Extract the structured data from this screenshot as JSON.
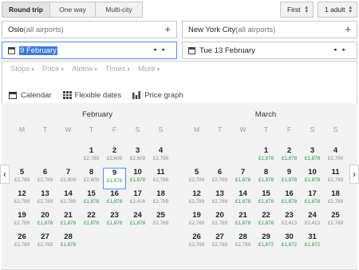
{
  "trip_type": {
    "options": [
      {
        "label": "Round trip",
        "selected": true
      },
      {
        "label": "One way",
        "selected": false
      },
      {
        "label": "Multi-city",
        "selected": false
      }
    ]
  },
  "cabin": {
    "value": "First"
  },
  "passengers": {
    "value": "1 adult"
  },
  "origin": {
    "value": "Oslo",
    "suffix": " (all airports)"
  },
  "destination": {
    "value": "New York City",
    "suffix": " (all airports)"
  },
  "depart": {
    "value": "9 February"
  },
  "return": {
    "value": "Tue 13 February"
  },
  "filters": [
    "Stops",
    "Price",
    "Airline",
    "Times",
    "More"
  ],
  "views": [
    {
      "label": "Calendar",
      "icon": "calendar-icon",
      "active": true
    },
    {
      "label": "Flexible dates",
      "icon": "grid-icon",
      "active": false
    },
    {
      "label": "Price graph",
      "icon": "bar-chart-icon",
      "active": false
    }
  ],
  "weekdays": [
    "M",
    "T",
    "W",
    "T",
    "F",
    "S",
    "S"
  ],
  "months": [
    {
      "name": "February",
      "weeks": [
        [
          null,
          null,
          null,
          {
            "d": "1",
            "p": "£2,789"
          },
          {
            "d": "2",
            "p": "£2,609"
          },
          {
            "d": "3",
            "p": "£2,609"
          },
          {
            "d": "4",
            "p": "£2,789"
          }
        ],
        [
          {
            "d": "5",
            "p": "£2,789"
          },
          {
            "d": "6",
            "p": "£2,789"
          },
          {
            "d": "7",
            "p": "£2,609"
          },
          {
            "d": "8",
            "p": "£2,609"
          },
          {
            "d": "9",
            "p": "£1,878",
            "g": true,
            "sel": true
          },
          {
            "d": "10",
            "p": "£1,878",
            "g": true
          },
          {
            "d": "11",
            "p": "£2,789"
          }
        ],
        [
          {
            "d": "12",
            "p": "£2,789"
          },
          {
            "d": "13",
            "p": "£2,789"
          },
          {
            "d": "14",
            "p": "£2,789"
          },
          {
            "d": "15",
            "p": "£1,878",
            "g": true
          },
          {
            "d": "16",
            "p": "£1,878",
            "g": true
          },
          {
            "d": "17",
            "p": "£2,416"
          },
          {
            "d": "18",
            "p": "£2,789"
          }
        ],
        [
          {
            "d": "19",
            "p": "£2,789"
          },
          {
            "d": "20",
            "p": "£1,878",
            "g": true
          },
          {
            "d": "21",
            "p": "£1,878",
            "g": true
          },
          {
            "d": "22",
            "p": "£1,878",
            "g": true
          },
          {
            "d": "23",
            "p": "£1,878",
            "g": true
          },
          {
            "d": "24",
            "p": "£1,878",
            "g": true
          },
          {
            "d": "25",
            "p": "£2,789"
          }
        ],
        [
          {
            "d": "26",
            "p": "£2,789"
          },
          {
            "d": "27",
            "p": "£2,789"
          },
          {
            "d": "28",
            "p": "£1,878",
            "g": true
          },
          null,
          null,
          null,
          null
        ]
      ]
    },
    {
      "name": "March",
      "weeks": [
        [
          null,
          null,
          null,
          {
            "d": "1",
            "p": "£1,878",
            "g": true
          },
          {
            "d": "2",
            "p": "£1,878",
            "g": true
          },
          {
            "d": "3",
            "p": "£1,878",
            "g": true
          },
          {
            "d": "4",
            "p": "£2,789"
          }
        ],
        [
          {
            "d": "5",
            "p": "£2,789"
          },
          {
            "d": "6",
            "p": "£2,789"
          },
          {
            "d": "7",
            "p": "£1,878",
            "g": true
          },
          {
            "d": "8",
            "p": "£1,878",
            "g": true
          },
          {
            "d": "9",
            "p": "£1,878",
            "g": true
          },
          {
            "d": "10",
            "p": "£1,878",
            "g": true
          },
          {
            "d": "11",
            "p": "£2,789"
          }
        ],
        [
          {
            "d": "12",
            "p": "£2,789"
          },
          {
            "d": "13",
            "p": "£2,789"
          },
          {
            "d": "14",
            "p": "£1,878",
            "g": true
          },
          {
            "d": "15",
            "p": "£1,878",
            "g": true
          },
          {
            "d": "16",
            "p": "£1,878",
            "g": true
          },
          {
            "d": "17",
            "p": "£1,878",
            "g": true
          },
          {
            "d": "18",
            "p": "£2,789"
          }
        ],
        [
          {
            "d": "19",
            "p": "£2,789"
          },
          {
            "d": "20",
            "p": "£2,789"
          },
          {
            "d": "21",
            "p": "£1,878",
            "g": true
          },
          {
            "d": "22",
            "p": "£1,878",
            "g": true
          },
          {
            "d": "23",
            "p": "£2,413"
          },
          {
            "d": "24",
            "p": "£2,413"
          },
          {
            "d": "25",
            "p": "£2,789"
          }
        ],
        [
          {
            "d": "26",
            "p": "£2,789"
          },
          {
            "d": "27",
            "p": "£2,789"
          },
          {
            "d": "28",
            "p": "£2,789"
          },
          {
            "d": "29",
            "p": "£1,872",
            "g": true
          },
          {
            "d": "30",
            "p": "£1,872",
            "g": true
          },
          {
            "d": "31",
            "p": "£1,872",
            "g": true
          },
          null
        ]
      ]
    }
  ],
  "colors": {
    "accent": "#3b78e7",
    "cheap": "#1e9c3b",
    "selected_border": "#4d90fe"
  }
}
